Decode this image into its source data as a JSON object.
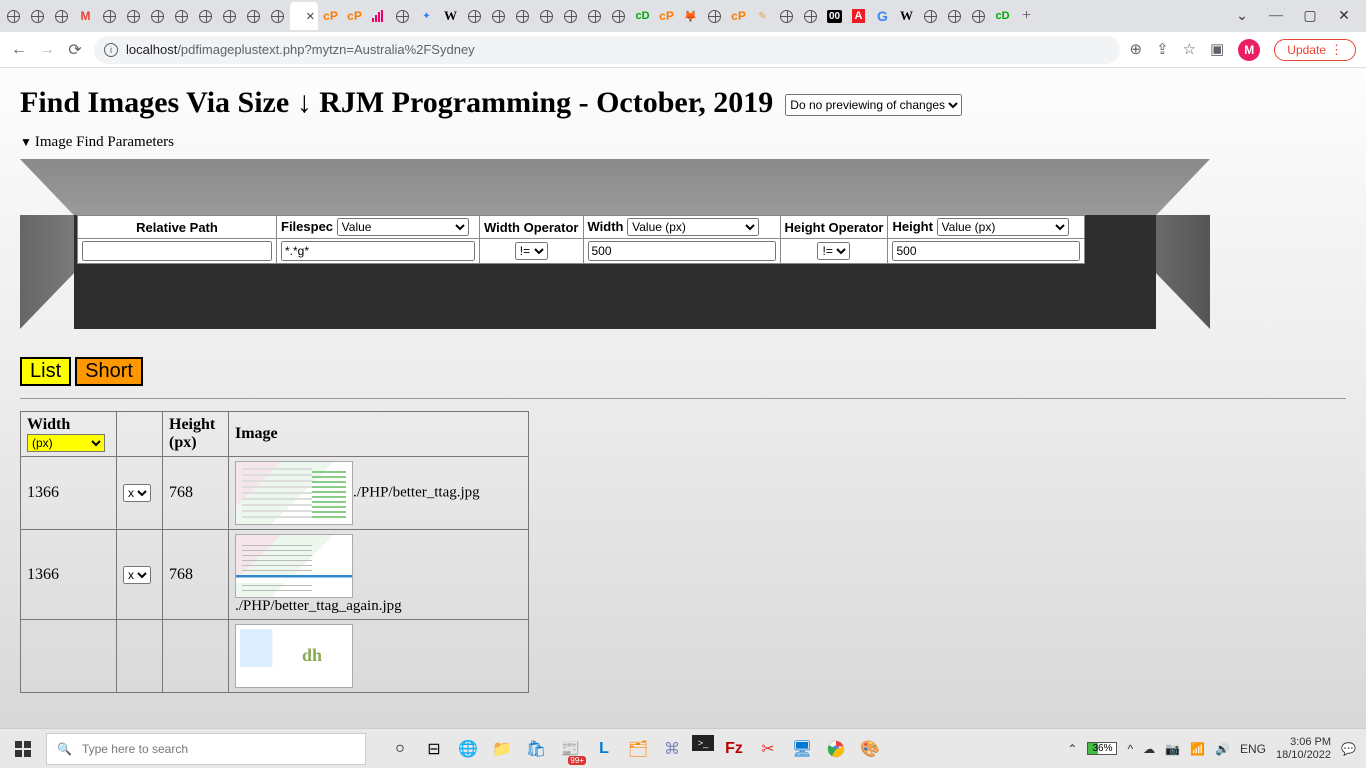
{
  "browser": {
    "url_host": "localhost",
    "url_path": "/pdfimageplustext.php?mytzn=Australia%2FSydney",
    "update": "Update",
    "avatar": "M",
    "win": {
      "chevron": "⌄",
      "min": "—",
      "max": "▢",
      "close": "✕"
    },
    "newtab": "+"
  },
  "page_header": {
    "title_a": "Find Images Via Size ",
    "title_arrow": "↓",
    "title_b": " RJM Programming - October, 2019",
    "preview_label": "Do no previewing of changes",
    "disclosure": "Image Find Parameters"
  },
  "params": {
    "relpath_h": "Relative Path",
    "filespec_h": "Filespec",
    "filespec_sel": "Value",
    "widthop_h": "Width Operator",
    "width_h": "Width",
    "width_sel": "Value (px)",
    "heightop_h": "Height Operator",
    "height_h": "Height",
    "height_sel": "Value (px)",
    "relpath_v": "",
    "filespec_v": "*.*g*",
    "widthop_v": "!=",
    "width_v": "500",
    "heightop_v": "!=",
    "height_v": "500"
  },
  "buttons": {
    "list": "List",
    "short": "Short"
  },
  "results": {
    "width_h": "Width",
    "px_sel": "(px)",
    "height_h": "Height",
    "height_hsub": "(px)",
    "image_h": "Image",
    "x_sel": "x",
    "rows": [
      {
        "w": "1366",
        "h": "768",
        "path": "./PHP/better_ttag.jpg"
      },
      {
        "w": "1366",
        "h": "768",
        "path": "./PHP/better_ttag_again.jpg"
      },
      {
        "w": "",
        "h": "",
        "path": ""
      }
    ]
  },
  "taskbar": {
    "search_placeholder": "Type here to search",
    "battery": "36%",
    "lang": "ENG",
    "time": "3:06 PM",
    "date": "18/10/2022",
    "news_badge": "99+"
  }
}
